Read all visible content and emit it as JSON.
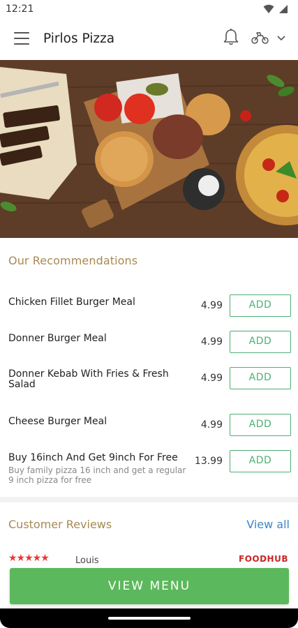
{
  "status_bar": {
    "time": "12:21"
  },
  "app_bar": {
    "title": "Pirlos Pizza"
  },
  "recommendations": {
    "title": "Our Recommendations",
    "items": [
      {
        "name": "Chicken Fillet Burger Meal",
        "description": "",
        "price": "4.99",
        "action": "ADD"
      },
      {
        "name": "Donner Burger Meal",
        "description": "",
        "price": "4.99",
        "action": "ADD"
      },
      {
        "name": "Donner Kebab With Fries & Fresh Salad",
        "description": "",
        "price": "4.99",
        "action": "ADD"
      },
      {
        "name": "Cheese Burger Meal",
        "description": "",
        "price": "4.99",
        "action": "ADD"
      },
      {
        "name": "Buy 16inch And Get 9inch For Free",
        "description": "Buy family pizza 16 inch and get a regular 9 inch pizza for free",
        "price": "13.99",
        "action": "ADD"
      }
    ]
  },
  "reviews": {
    "title": "Customer Reviews",
    "view_all": "View all",
    "first_review": {
      "stars": 5,
      "reviewer": "Louis",
      "source": "FOODHUB"
    }
  },
  "footer": {
    "view_menu": "VIEW MENU"
  },
  "colors": {
    "accent_green": "#5cb85c",
    "section_gold": "#a78a52",
    "link_blue": "#3a86c8",
    "star_red": "#e53935"
  },
  "icons": [
    "menu-icon",
    "bell-icon",
    "scooter-icon",
    "chevron-down-icon",
    "wifi-icon",
    "signal-icon"
  ]
}
